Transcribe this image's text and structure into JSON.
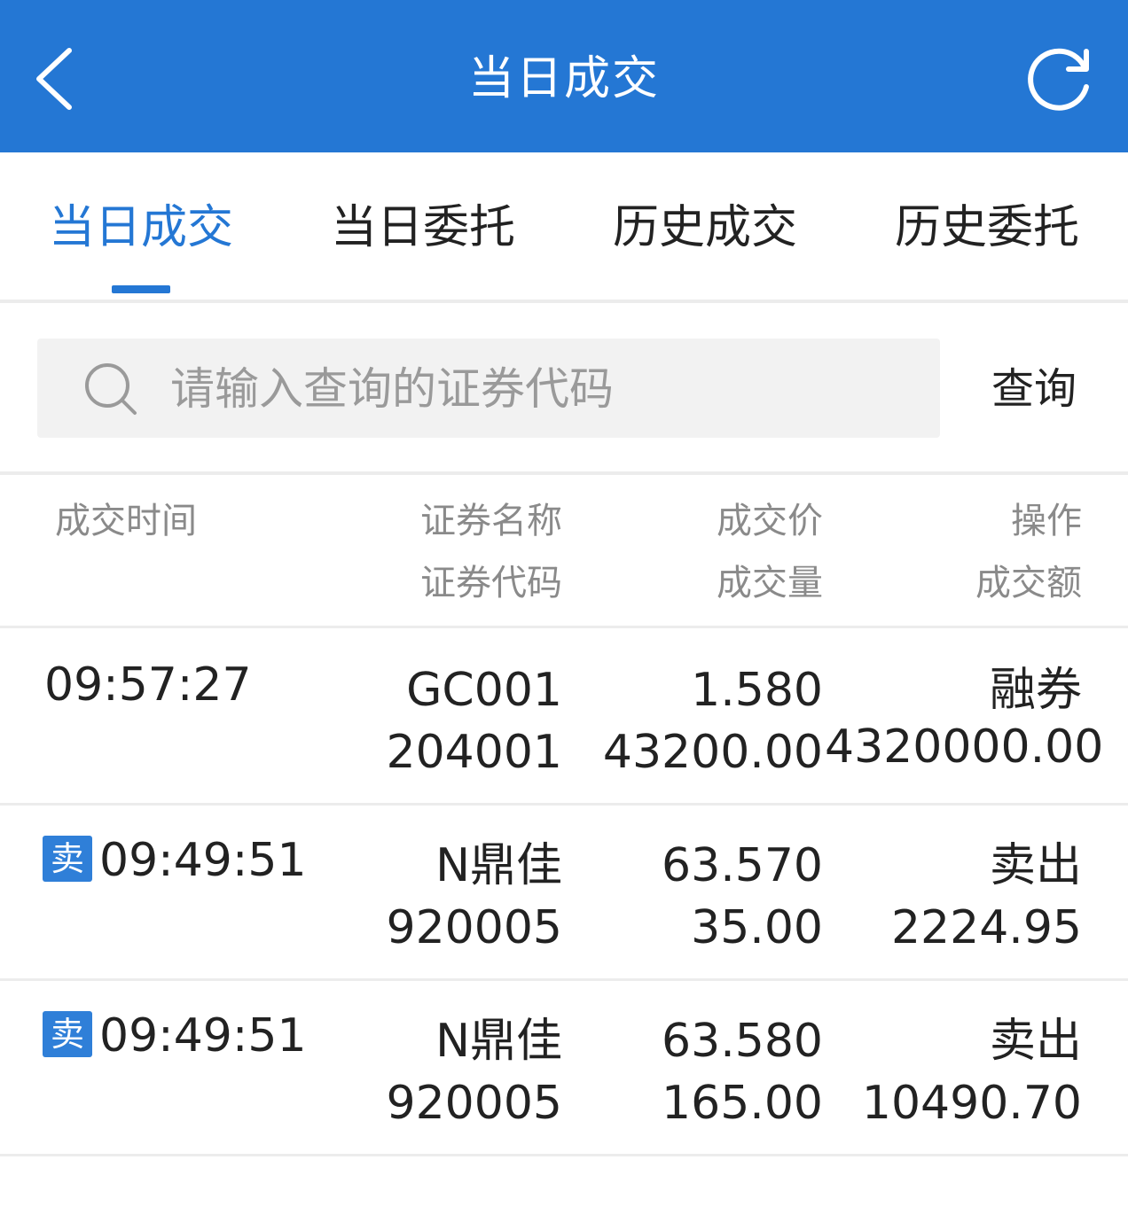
{
  "header": {
    "title": "当日成交",
    "back_icon": "chevron-left-icon",
    "refresh_icon": "refresh-icon",
    "color": "#2477d4"
  },
  "tabs": [
    {
      "label": "当日成交",
      "active": true
    },
    {
      "label": "当日委托",
      "active": false
    },
    {
      "label": "历史成交",
      "active": false
    },
    {
      "label": "历史委托",
      "active": false
    }
  ],
  "search": {
    "placeholder": "请输入查询的证券代码",
    "value": "",
    "button_label": "查询"
  },
  "table": {
    "headers": {
      "time": "成交时间",
      "name": "证券名称",
      "code": "证券代码",
      "price": "成交价",
      "volume": "成交量",
      "action": "操作",
      "amount": "成交额"
    },
    "rows": [
      {
        "badge": "",
        "time": "09:57:27",
        "name": "GC001",
        "code": "204001",
        "price": "1.580",
        "volume": "43200.00",
        "action": "融券",
        "amount": "4320000.00"
      },
      {
        "badge": "卖",
        "time": "09:49:51",
        "name": "N鼎佳",
        "code": "920005",
        "price": "63.570",
        "volume": "35.00",
        "action": "卖出",
        "amount": "2224.95"
      },
      {
        "badge": "卖",
        "time": "09:49:51",
        "name": "N鼎佳",
        "code": "920005",
        "price": "63.580",
        "volume": "165.00",
        "action": "卖出",
        "amount": "10490.70"
      }
    ]
  }
}
